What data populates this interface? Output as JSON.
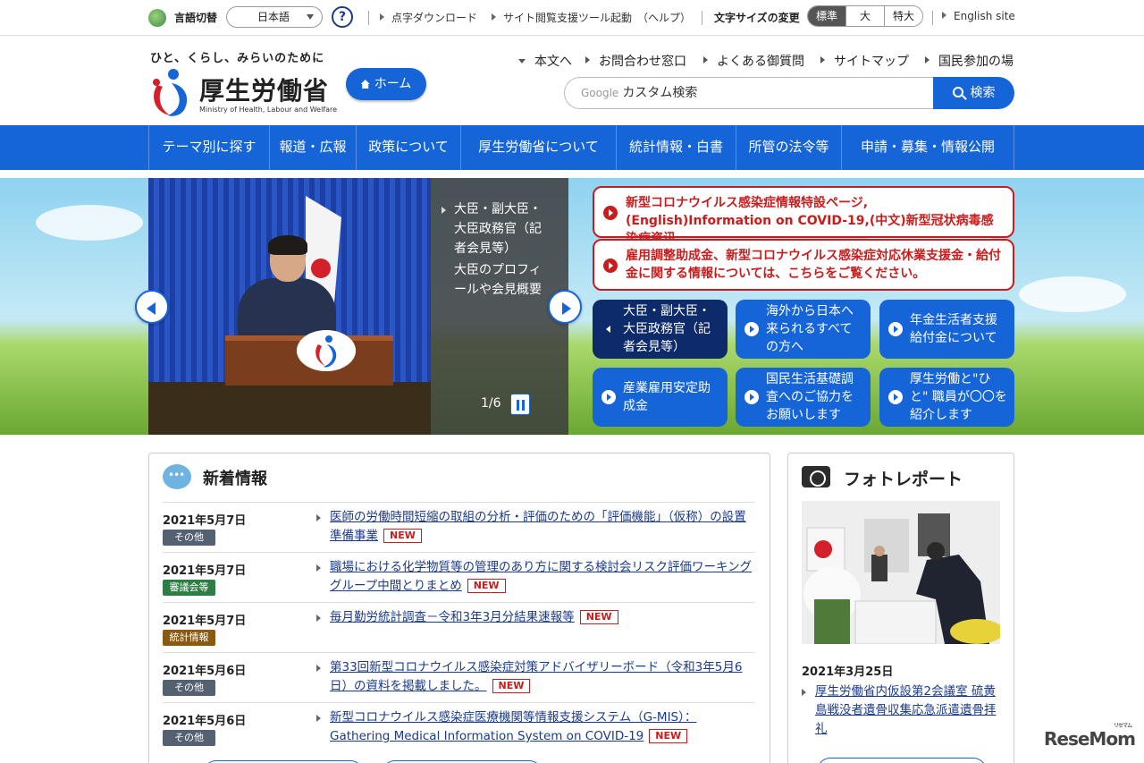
{
  "utility": {
    "language_label": "言語切替",
    "language_value": "日本語",
    "help_label": "?",
    "links": [
      "点字ダウンロード",
      "サイト閲覧支援ツール起動",
      "（ヘルプ）"
    ],
    "font_size_label": "文字サイズの変更",
    "font_sizes": [
      "標準",
      "大",
      "特大"
    ],
    "english_site": "English site"
  },
  "header": {
    "tagline": "ひと、くらし、みらいのために",
    "logo_text": "厚生労働省",
    "logo_en": "Ministry of Health, Labour and Welfare",
    "home_label": "ホーム",
    "links": [
      "本文へ",
      "お問合わせ窓口",
      "よくある御質問",
      "サイトマップ",
      "国民参加の場"
    ],
    "search_google": "Google",
    "search_placeholder": "カスタム検索",
    "search_button": "検索"
  },
  "gnav": [
    "テーマ別に探す",
    "報道・広報",
    "政策について",
    "厚生労働省について",
    "統計情報・白書",
    "所管の法令等",
    "申請・募集・情報公開"
  ],
  "hero": {
    "caption": [
      "大臣・副大臣・大臣政務官（記者会見等）",
      "大臣のプロフィールや会見概要"
    ],
    "counter": "1/6",
    "alerts": [
      "新型コロナウイルス感染症情報特設ページ,(English)Information on COVID-19,(中文)新型冠状病毒感染症资讯",
      "雇用調整助成金、新型コロナウイルス感染症対応休業支援金・給付金に関する情報については、こちらをご覧ください。"
    ],
    "tiles": [
      "大臣・副大臣・大臣政務官（記者会見等）",
      "海外から日本へ来られるすべての方へ",
      "年金生活者支援給付金について",
      "産業雇用安定助成金",
      "国民生活基礎調査へのご協力をお願いします",
      "厚生労働と\"ひと\" 職員が〇〇を紹介します"
    ]
  },
  "news": {
    "title": "新着情報",
    "new_badge": "NEW",
    "items": [
      {
        "date": "2021年5月7日",
        "category": "その他",
        "text": "医師の労働時間短縮の取組の分析・評価のための「評価機能」（仮称）の設置準備事業"
      },
      {
        "date": "2021年5月7日",
        "category": "審議会等",
        "text": "職場における化学物質等の管理のあり方に関する検討会リスク評価ワーキンググループ中間とりまとめ"
      },
      {
        "date": "2021年5月7日",
        "category": "統計情報",
        "text": "毎月勤労統計調査－令和3年3月分結果速報等"
      },
      {
        "date": "2021年5月6日",
        "category": "その他",
        "text": "第33回新型コロナウイルス感染症対策アドバイザリーボード（令和3年5月6日）の資料を掲載しました。"
      },
      {
        "date": "2021年5月6日",
        "category": "その他",
        "text": "新型コロナウイルス感染症医療機関等情報支援システム（G-MIS）：Gathering Medical Information System on COVID-19"
      }
    ]
  },
  "photo_report": {
    "title": "フォトレポート",
    "date": "2021年3月25日",
    "link": "厚生労働省内仮設第2会議室 硫黄島戦没者遺骨収集応急派遣遺骨拝礼"
  },
  "watermark": {
    "text": "ReseMom",
    "sub": "リセマム"
  },
  "colors": {
    "brand_blue": "#1565d8",
    "alert_red": "#c91d1d",
    "dark_navy": "#0d2a6b",
    "cat_other": "#556070",
    "cat_council": "#2e7d45",
    "cat_stats": "#8a5a12"
  }
}
